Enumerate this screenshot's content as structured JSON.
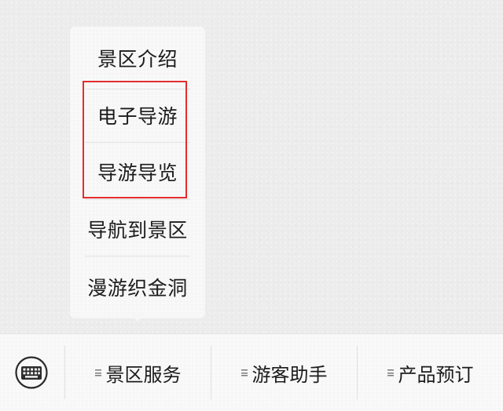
{
  "submenu": {
    "items": [
      {
        "label": "景区介绍"
      },
      {
        "label": "电子导游"
      },
      {
        "label": "导游导览"
      },
      {
        "label": "导航到景区"
      },
      {
        "label": "漫游织金洞"
      }
    ]
  },
  "annotation": {
    "color": "#e32d2d"
  },
  "bottom_menu": {
    "keyboard_icon": "keyboard-icon",
    "tabs": [
      {
        "label": "景区服务"
      },
      {
        "label": "游客助手"
      },
      {
        "label": "产品预订"
      }
    ]
  }
}
